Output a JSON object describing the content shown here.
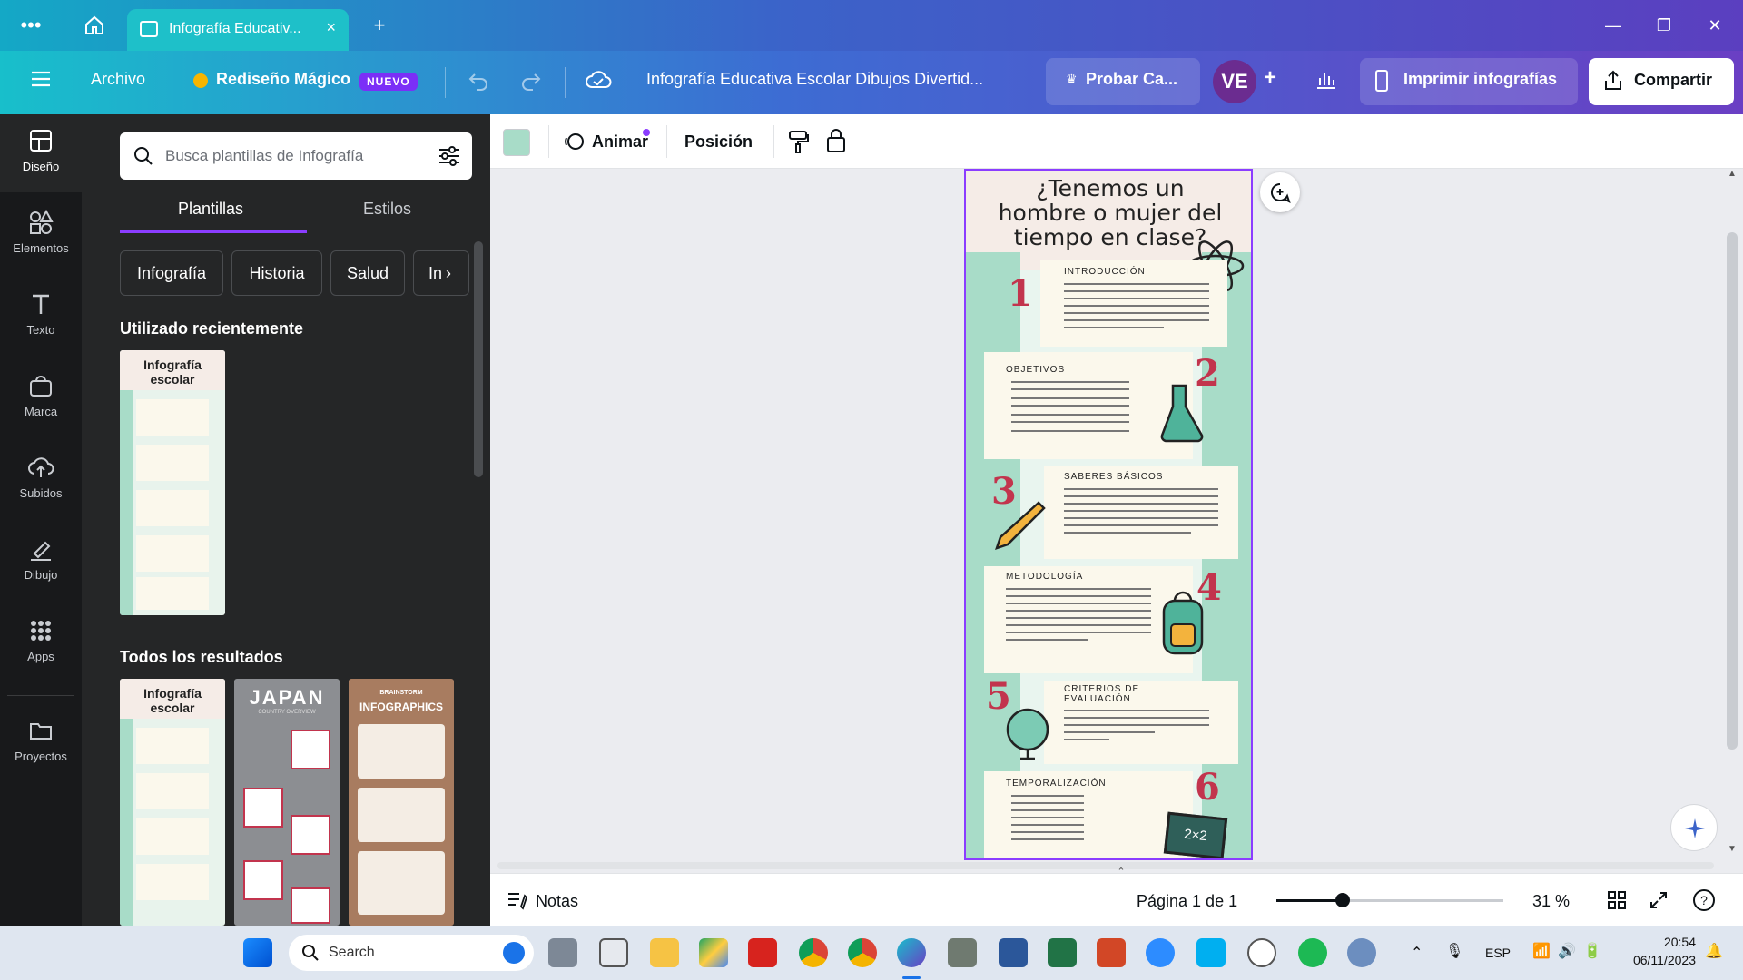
{
  "browser": {
    "tab_title": "Infografía Educativ...",
    "tab_close": "×",
    "new_tab": "+",
    "more": "•••"
  },
  "toolbar": {
    "menu_icon": "hamburger-icon",
    "file": "Archivo",
    "magic_redesign": "Rediseño Mágico",
    "new_badge": "NUEVO",
    "document_title": "Infografía Educativa Escolar Dibujos Divertid...",
    "try_canva": "Probar Ca...",
    "avatar_initials": "VE",
    "add": "+",
    "print_label": "Imprimir infografías",
    "share_label": "Compartir"
  },
  "rail": [
    {
      "label": "Diseño",
      "icon": "layout-icon"
    },
    {
      "label": "Elementos",
      "icon": "shapes-icon"
    },
    {
      "label": "Texto",
      "icon": "text-icon"
    },
    {
      "label": "Marca",
      "icon": "brand-icon"
    },
    {
      "label": "Subidos",
      "icon": "upload-icon"
    },
    {
      "label": "Dibujo",
      "icon": "draw-icon"
    },
    {
      "label": "Apps",
      "icon": "apps-icon"
    },
    {
      "label": "Proyectos",
      "icon": "folder-icon"
    }
  ],
  "panel": {
    "search_placeholder": "Busca plantillas de Infografía",
    "tabs": [
      "Plantillas",
      "Estilos"
    ],
    "chips": [
      "Infografía",
      "Historia",
      "Salud",
      "In"
    ],
    "recent_title": "Utilizado recientemente",
    "all_title": "Todos los resultados",
    "recent_thumb_title": "Infografía escolar",
    "results": [
      {
        "title": "Infografía escolar"
      },
      {
        "title": "JAPAN",
        "subtitle": "COUNTRY OVERVIEW"
      },
      {
        "title": "BRAINSTORM",
        "subtitle": "INFOGRAPHICS"
      }
    ]
  },
  "ctxbar": {
    "color": "#a8dcc8",
    "animate": "Animar",
    "position": "Posición"
  },
  "infographic": {
    "title": "¿Tenemos un hombre o mujer del tiempo en clase?",
    "sections": [
      {
        "num": "1",
        "heading": "INTRODUCCIÓN"
      },
      {
        "num": "2",
        "heading": "OBJETIVOS"
      },
      {
        "num": "3",
        "heading": "SABERES BÁSICOS"
      },
      {
        "num": "4",
        "heading": "METODOLOGÍA"
      },
      {
        "num": "5",
        "heading": "CRITERIOS DE EVALUACIÓN"
      },
      {
        "num": "6",
        "heading": "TEMPORALIZACIÓN"
      }
    ],
    "chalk": "2×2"
  },
  "footer": {
    "notes": "Notas",
    "page": "Página 1 de 1",
    "zoom": "31 %",
    "zoom_fraction": 0.29
  },
  "taskbar": {
    "search": "Search",
    "lang": "ESP",
    "time": "20:54",
    "date": "06/11/2023"
  }
}
